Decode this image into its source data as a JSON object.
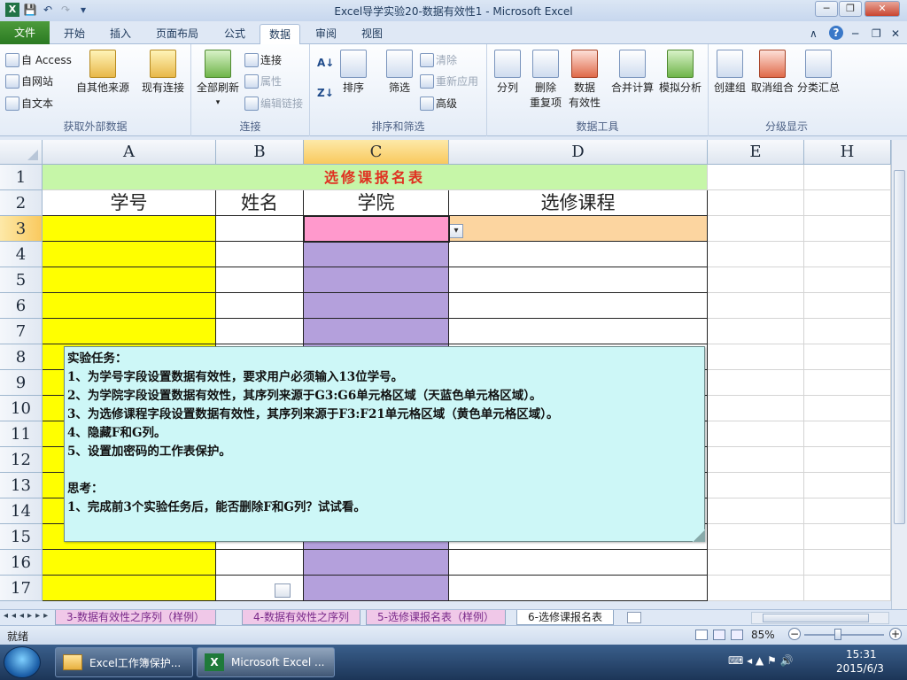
{
  "window": {
    "title": "Excel导学实验20-数据有效性1  -  Microsoft Excel",
    "qa_save": "💾",
    "qa_undo": "↶",
    "qa_redo": "↷",
    "qa_more": "▾",
    "min": "─",
    "max": "❐",
    "close": "✕"
  },
  "ribbon_tabs": {
    "file": "文件",
    "home": "开始",
    "insert": "插入",
    "layout": "页面布局",
    "formula": "公式",
    "data": "数据",
    "review": "审阅",
    "view": "视图"
  },
  "tab_right": {
    "up": "∧",
    "help": "?",
    "min": "─",
    "restore": "❐",
    "close": "✕"
  },
  "ribbon": {
    "ext": {
      "access": "自 Access",
      "web": "自网站",
      "text": "自文本",
      "other": "自其他来源",
      "existing": "现有连接",
      "label": "获取外部数据"
    },
    "conn": {
      "refresh": "全部刷新",
      "connections": "连接",
      "properties": "属性",
      "edit_links": "编辑链接",
      "label": "连接"
    },
    "sort": {
      "sort": "排序",
      "filter": "筛选",
      "clear": "清除",
      "reapply": "重新应用",
      "advanced": "高级",
      "label": "排序和筛选",
      "az": "A↓",
      "za": "Z↓"
    },
    "tools": {
      "text_to_cols": "分列",
      "remove_dup_1": "删除",
      "remove_dup_2": "重复项",
      "validation_1": "数据",
      "validation_2": "有效性",
      "consolidate": "合并计算",
      "whatif": "模拟分析",
      "label": "数据工具"
    },
    "outline": {
      "group": "创建组",
      "ungroup": "取消组合",
      "subtotal": "分类汇总",
      "label": "分级显示"
    }
  },
  "columns": [
    "A",
    "B",
    "C",
    "D",
    "E",
    "H"
  ],
  "rows": [
    "1",
    "2",
    "3",
    "4",
    "5",
    "6",
    "7",
    "8",
    "9",
    "10",
    "11",
    "12",
    "13",
    "14",
    "15",
    "16",
    "17"
  ],
  "sheet": {
    "title": "选修课报名表",
    "headers": {
      "id": "学号",
      "name": "姓名",
      "college": "学院",
      "course": "选修课程"
    },
    "dropdown_arrow": "▾"
  },
  "note": {
    "lines": [
      "实验任务：",
      "1、为学号字段设置数据有效性，要求用户必须输入13位学号。",
      "2、为学院字段设置数据有效性，其序列来源于G3:G6单元格区域（天蓝色单元格区域）。",
      "3、为选修课程字段设置数据有效性，其序列来源于F3:F21单元格区域（黄色单元格区域）。",
      "4、隐藏F和G列。",
      "5、设置加密码的工作表保护。",
      "",
      "思考：",
      "1、完成前3个实验任务后，能否删除F和G列？试试看。"
    ]
  },
  "sheet_tabs": [
    "3-数据有效性之序列（样例）",
    "4-数据有效性之序列",
    "5-选修课报名表（样例）",
    "6-选修课报名表"
  ],
  "status": {
    "ready": "就绪",
    "zoom": "85%",
    "minus": "−",
    "plus": "+"
  },
  "taskbar": {
    "btn1": "Excel工作簿保护...",
    "btn2": "Microsoft Excel ...",
    "time": "15:31",
    "date": "2015/6/3",
    "tray": "⌨ ◂ ▲ ⚑ 🔊"
  },
  "colors": {
    "yellow": "#ffff00",
    "pink": "#ff99cc",
    "purple": "#b4a0dc",
    "peach": "#fcd5a0",
    "green": "#c6f6a8",
    "title_red": "#e03020",
    "note_bg": "#cdf7f7"
  }
}
